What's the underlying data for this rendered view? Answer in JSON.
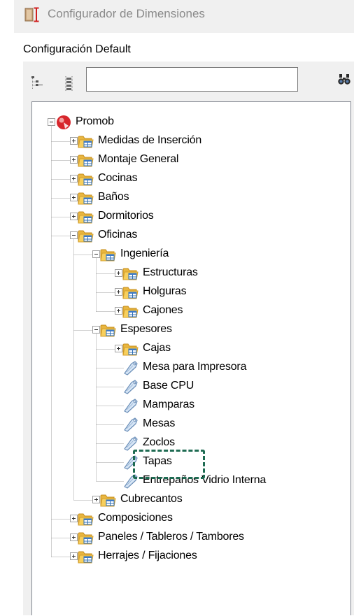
{
  "window": {
    "title": "Configurador de Dimensiones",
    "icon": "dimension-configurator-icon"
  },
  "config_label": "Configuración Default",
  "toolbar": {
    "search_value": "",
    "expand_icon": "expand-all-icon",
    "collapse_icon": "collapse-all-icon",
    "find_icon": "binoculars-icon"
  },
  "colors": {
    "titlebar_bg": "#f0f0f0",
    "panel_bg": "#f0f0f0",
    "folder": "#f7cf5d",
    "highlight": "#1e6b52",
    "root_icon": "#d7262c"
  },
  "tree": {
    "root": "Promob",
    "nodes": [
      {
        "label": "Medidas de Inserción",
        "depth": 1,
        "type": "folder",
        "state": "collapsed"
      },
      {
        "label": "Montaje General",
        "depth": 1,
        "type": "folder",
        "state": "collapsed"
      },
      {
        "label": "Cocinas",
        "depth": 1,
        "type": "folder",
        "state": "collapsed"
      },
      {
        "label": "Baños",
        "depth": 1,
        "type": "folder",
        "state": "collapsed"
      },
      {
        "label": "Dormitorios",
        "depth": 1,
        "type": "folder",
        "state": "collapsed"
      },
      {
        "label": "Oficinas",
        "depth": 1,
        "type": "folder",
        "state": "expanded"
      },
      {
        "label": "Ingeniería",
        "depth": 2,
        "type": "folder",
        "state": "expanded"
      },
      {
        "label": "Estructuras",
        "depth": 3,
        "type": "folder",
        "state": "collapsed"
      },
      {
        "label": "Holguras",
        "depth": 3,
        "type": "folder",
        "state": "collapsed"
      },
      {
        "label": "Cajones",
        "depth": 3,
        "type": "folder",
        "state": "collapsed"
      },
      {
        "label": "Espesores",
        "depth": 2,
        "type": "folder",
        "state": "expanded"
      },
      {
        "label": "Cajas",
        "depth": 3,
        "type": "folder",
        "state": "collapsed"
      },
      {
        "label": "Mesa para Impresora",
        "depth": 3,
        "type": "item"
      },
      {
        "label": "Base CPU",
        "depth": 3,
        "type": "item"
      },
      {
        "label": "Mamparas",
        "depth": 3,
        "type": "item"
      },
      {
        "label": "Mesas",
        "depth": 3,
        "type": "item",
        "highlighted": true
      },
      {
        "label": "Zoclos",
        "depth": 3,
        "type": "item"
      },
      {
        "label": "Tapas",
        "depth": 3,
        "type": "item"
      },
      {
        "label": "Entrepaños Vidrio Interna",
        "depth": 3,
        "type": "item"
      },
      {
        "label": "Cubrecantos",
        "depth": 2,
        "type": "folder",
        "state": "collapsed"
      },
      {
        "label": "Composiciones",
        "depth": 1,
        "type": "folder",
        "state": "collapsed"
      },
      {
        "label": "Paneles / Tableros / Tambores",
        "depth": 1,
        "type": "folder",
        "state": "collapsed"
      },
      {
        "label": "Herrajes / Fijaciones",
        "depth": 1,
        "type": "folder",
        "state": "collapsed"
      }
    ]
  }
}
